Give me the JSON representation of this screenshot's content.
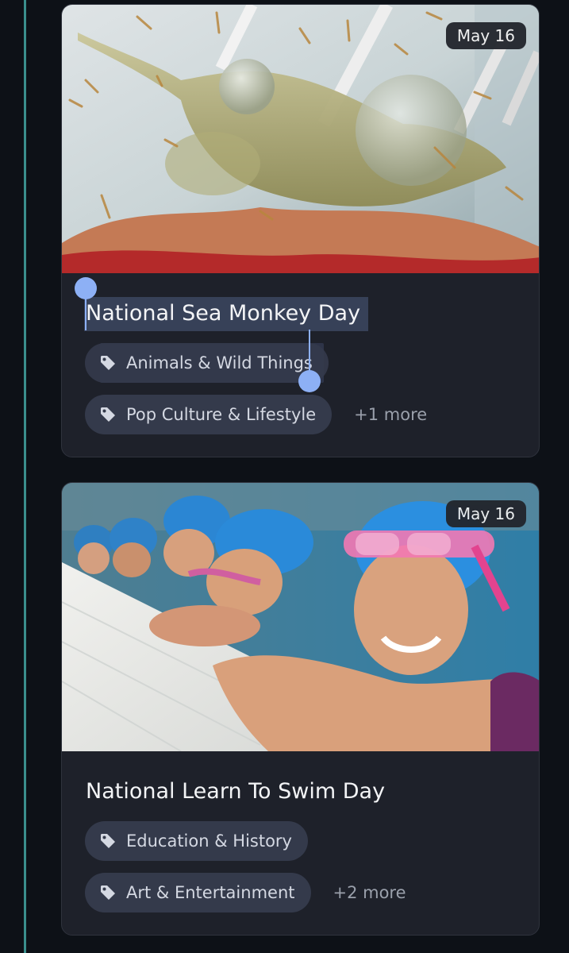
{
  "cards": [
    {
      "date": "May 16",
      "title": "National Sea Monkey Day",
      "tags": [
        "Animals & Wild Things",
        "Pop Culture & Lifestyle"
      ],
      "more": "+1 more",
      "image_icon": "sea-monkey-tank-photo"
    },
    {
      "date": "May 16",
      "title": "National Learn To Swim Day",
      "tags": [
        "Education & History",
        "Art & Entertainment"
      ],
      "more": "+2 more",
      "image_icon": "kids-swimming-pool-photo"
    }
  ],
  "colors": {
    "background": "#0d1117",
    "card": "#1e212a",
    "tag_pill": "#343a4b",
    "selection_handle": "#8db0f5",
    "rail": "#3a8f8d"
  },
  "icons": {
    "tag": "tag-icon"
  }
}
